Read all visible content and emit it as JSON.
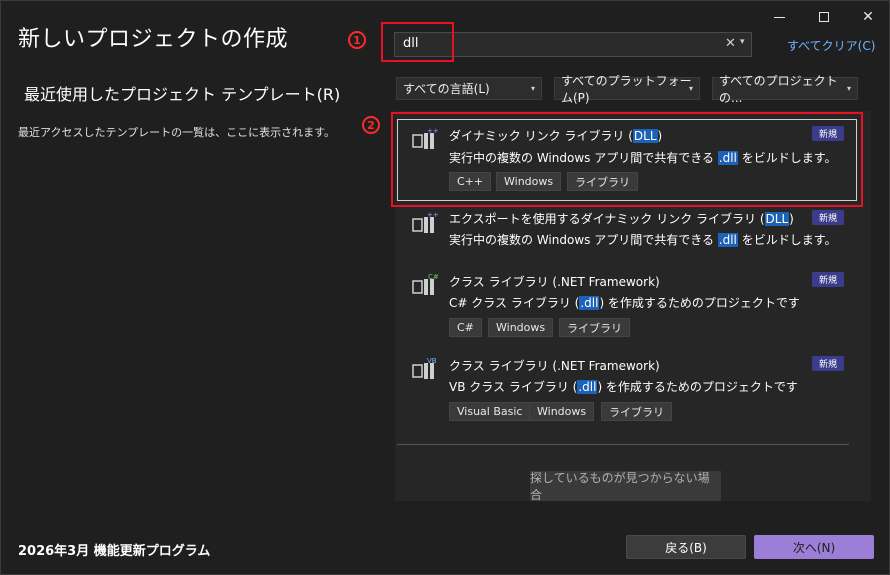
{
  "window": {
    "title": "新しいプロジェクトの作成",
    "controls": {
      "minimize_icon": "minimize-icon",
      "maximize_icon": "maximize-icon",
      "close_icon": "close-icon",
      "close_glyph": "✕"
    }
  },
  "search": {
    "value": "dll",
    "clear_glyph": "✕",
    "dropdown_glyph": "▾",
    "clear_all": "すべてクリア(C)"
  },
  "annotations": {
    "one": "1",
    "two": "2",
    "color": "#e81123"
  },
  "recent": {
    "title": "最近使用したプロジェクト テンプレート(R)",
    "empty_message": "最近アクセスしたテンプレートの一覧は、ここに表示されます。"
  },
  "filters": {
    "language": "すべての言語(L)",
    "platform": "すべてのプラットフォーム(P)",
    "project_type": "すべてのプロジェクトの...",
    "caret": "▾"
  },
  "templates": [
    {
      "name_pre": "ダイナミック リンク ライブラリ (",
      "name_hl": "DLL",
      "name_post": ")",
      "desc_pre": "実行中の複数の Windows アプリ間で共有できる ",
      "desc_hl": ".dll",
      "desc_post": " をビルドします。",
      "badge": "新規",
      "tags": [
        "C++",
        "Windows",
        "ライブラリ"
      ],
      "icon": "cpp-library-icon"
    },
    {
      "name_pre": "エクスポートを使用するダイナミック リンク ライブラリ (",
      "name_hl": "DLL",
      "name_post": ")",
      "desc_pre": "実行中の複数の Windows アプリ間で共有できる ",
      "desc_hl": ".dll",
      "desc_post": " をビルドします。",
      "badge": "新規",
      "tags": [],
      "icon": "cpp-library-icon"
    },
    {
      "name_pre": "クラス ライブラリ (.NET Framework)",
      "name_hl": "",
      "name_post": "",
      "desc_pre": "C# クラス ライブラリ (",
      "desc_hl": ".dll",
      "desc_post": ") を作成するためのプロジェクトです",
      "badge": "新規",
      "tags": [
        "C#",
        "Windows",
        "ライブラリ"
      ],
      "icon": "csharp-library-icon"
    },
    {
      "name_pre": "クラス ライブラリ (.NET Framework)",
      "name_hl": "",
      "name_post": "",
      "desc_pre": "VB クラス ライブラリ (",
      "desc_hl": ".dll",
      "desc_post": ") を作成するためのプロジェクトです",
      "badge": "新規",
      "tags": [
        "Visual Basic",
        "Windows",
        "ライブラリ"
      ],
      "icon": "vb-library-icon"
    }
  ],
  "not_found_button": "探しているものが見つからない場合",
  "footer": {
    "update_text": "2026年3月 機能更新プログラム",
    "back": "戻る(B)",
    "next": "次へ(N)"
  },
  "colors": {
    "accent": "#9b7fd6",
    "highlight": "#1b62b8",
    "badge": "#3c3c8c",
    "link": "#6fb4ff"
  }
}
